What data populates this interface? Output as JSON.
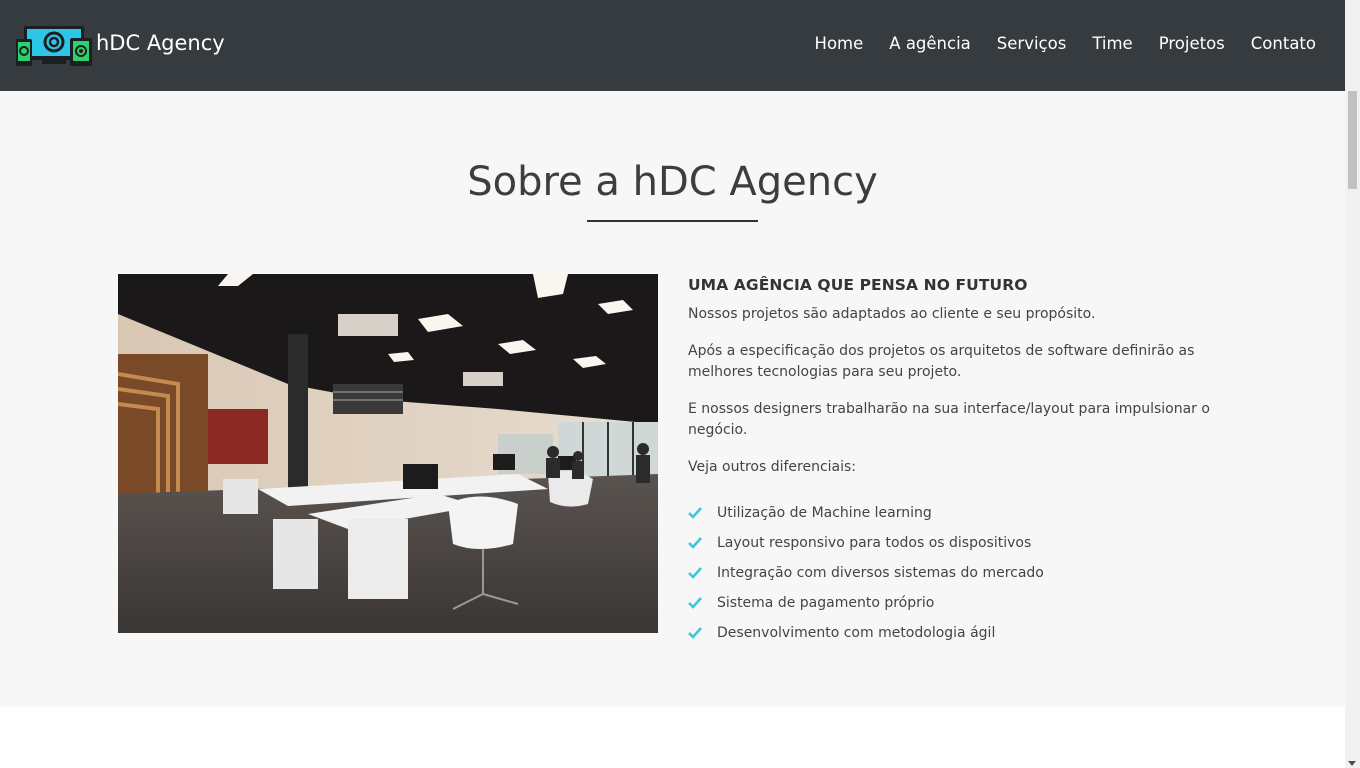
{
  "header": {
    "brand_name": "hDC Agency",
    "brand_logo": "devices-logo-icon",
    "background": "#353b3e",
    "nav": [
      {
        "label": "Home"
      },
      {
        "label": "A agência"
      },
      {
        "label": "Serviços"
      },
      {
        "label": "Time"
      },
      {
        "label": "Projetos"
      },
      {
        "label": "Contato"
      }
    ]
  },
  "about": {
    "title": "Sobre a hDC Agency",
    "image": "office-photo",
    "headline": "UMA AGÊNCIA QUE PENSA NO FUTURO",
    "paragraphs": [
      "Nossos projetos são adaptados ao cliente e seu propósito.",
      "Após a especificação dos projetos os arquitetos de software definirão as melhores tecnologias para seu projeto.",
      "E nossos designers trabalharão na sua interface/layout para impulsionar o negócio.",
      "Veja outros diferenciais:"
    ],
    "features": [
      {
        "label": "Utilização de Machine learning"
      },
      {
        "label": "Layout responsivo para todos os dispositivos"
      },
      {
        "label": "Integração com diversos sistemas do mercado"
      },
      {
        "label": "Sistema de pagamento próprio"
      },
      {
        "label": "Desenvolvimento com metodologia ágil"
      }
    ],
    "accent_color": "#3ec6e0",
    "background": "#f7f7f7"
  }
}
